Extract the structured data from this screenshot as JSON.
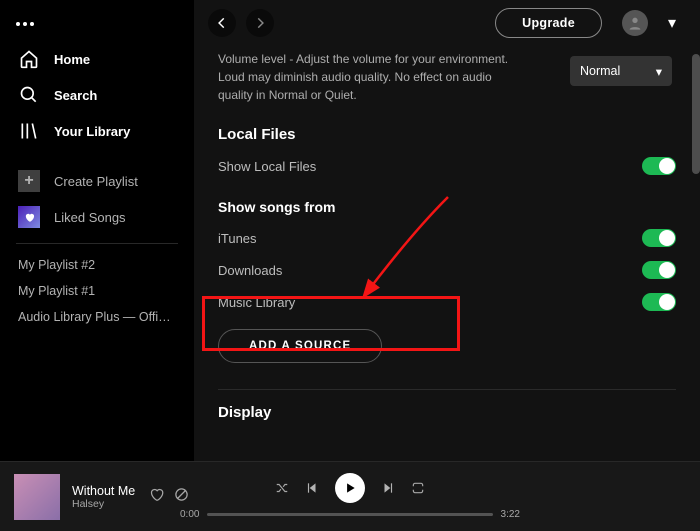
{
  "sidebar": {
    "home": "Home",
    "search": "Search",
    "library": "Your Library",
    "create": "Create Playlist",
    "liked": "Liked Songs",
    "playlists": [
      "My Playlist #2",
      "My Playlist #1",
      "Audio Library Plus — Officia..."
    ]
  },
  "topbar": {
    "upgrade": "Upgrade"
  },
  "settings": {
    "volume_help": "Volume level - Adjust the volume for your environment. Loud may diminish audio quality. No effect on audio quality in Normal or Quiet.",
    "quality_value": "Normal",
    "local_files_header": "Local Files",
    "show_local": "Show Local Files",
    "show_songs_header": "Show songs from",
    "sources": [
      "iTunes",
      "Downloads",
      "Music Library"
    ],
    "add_source": "ADD A SOURCE",
    "display_header": "Display"
  },
  "player": {
    "title": "Without Me",
    "artist": "Halsey",
    "current": "0:00",
    "total": "3:22"
  }
}
